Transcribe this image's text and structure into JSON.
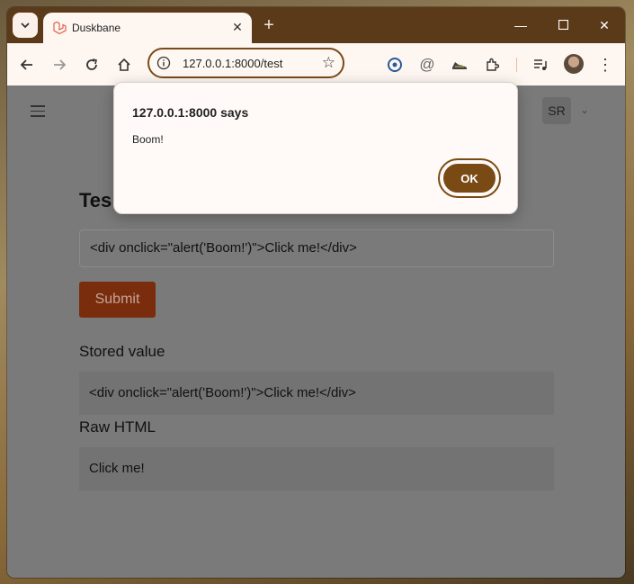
{
  "browser": {
    "tab": {
      "title": "Duskbane"
    },
    "address_bar": {
      "url": "127.0.0.1:8000/test"
    }
  },
  "page": {
    "user_initials": "SR",
    "heading": "Tes",
    "input_value": "<div onclick=\"alert('Boom!')\">Click me!</div>",
    "submit_label": "Submit",
    "stored_value": {
      "title": "Stored value",
      "value": "<div onclick=\"alert('Boom!')\">Click me!</div>"
    },
    "raw_html": {
      "title": "Raw HTML",
      "value": "Click me!"
    }
  },
  "dialog": {
    "title": "127.0.0.1:8000 says",
    "message": "Boom!",
    "ok_label": "OK"
  },
  "colors": {
    "titlebar": "#5b3a1a",
    "accent": "#7a4a14",
    "submit_button": "#7a2d0c"
  },
  "icons": [
    "tab-search-icon",
    "laravel-favicon-icon",
    "close-icon",
    "new-tab-icon",
    "minimize-icon",
    "maximize-icon",
    "window-close-icon",
    "back-icon",
    "forward-icon",
    "reload-icon",
    "home-icon",
    "site-info-icon",
    "bookmark-star-icon",
    "password-manager-icon",
    "at-icon",
    "sneaker-extension-icon",
    "extensions-icon",
    "media-queue-icon",
    "profile-avatar-icon",
    "menu-icon",
    "hamburger-icon",
    "chevron-down-icon"
  ]
}
